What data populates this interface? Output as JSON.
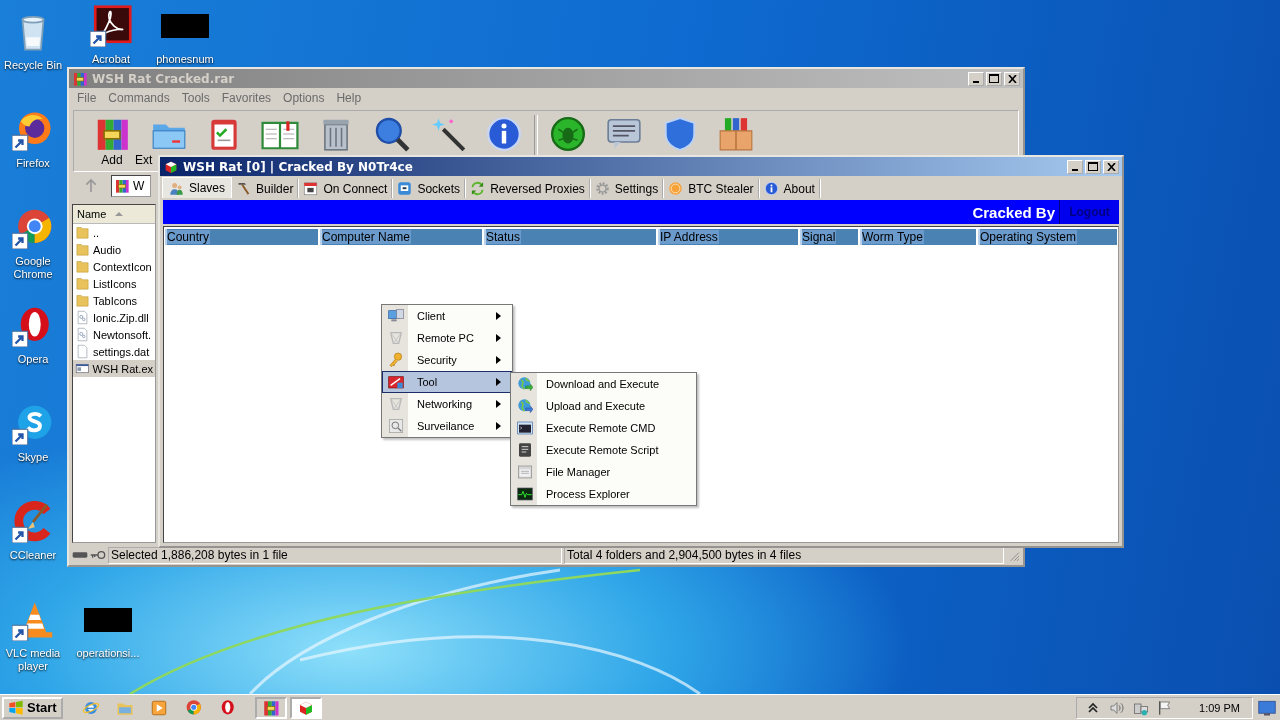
{
  "desktop_icons": [
    {
      "label": "Recycle Bin",
      "kind": "recycle"
    },
    {
      "label": "Acrobat",
      "kind": "acrobat"
    },
    {
      "label": "phonesnum",
      "kind": "redacted"
    },
    {
      "label": "Firefox",
      "kind": "firefox"
    },
    {
      "label": "Google Chrome",
      "kind": "chrome"
    },
    {
      "label": "Opera",
      "kind": "opera"
    },
    {
      "label": "Skype",
      "kind": "skype"
    },
    {
      "label": "CCleaner",
      "kind": "ccleaner"
    },
    {
      "label": "VLC media player",
      "kind": "vlc"
    },
    {
      "label": "operationsi...",
      "kind": "redacted"
    }
  ],
  "archiver_window": {
    "title": "WSH Rat Cracked.rar",
    "menu": [
      "File",
      "Commands",
      "Tools",
      "Favorites",
      "Options",
      "Help"
    ],
    "toolbar": [
      {
        "label": "Add",
        "kind": "books"
      },
      {
        "label": "Ext",
        "kind": "bluefolder"
      },
      {
        "kind": "clipboard"
      },
      {
        "kind": "book"
      },
      {
        "kind": "trash"
      },
      {
        "kind": "magnifier"
      },
      {
        "kind": "wand"
      },
      {
        "kind": "info"
      },
      {
        "kind": "bug"
      },
      {
        "kind": "message"
      },
      {
        "kind": "shield"
      },
      {
        "kind": "box"
      }
    ],
    "path": "W",
    "list_column": "Name",
    "files": [
      {
        "name": "..",
        "kind": "folder",
        "selected": false
      },
      {
        "name": "Audio",
        "kind": "folder",
        "selected": false
      },
      {
        "name": "ContextIcon",
        "kind": "folder",
        "selected": false
      },
      {
        "name": "ListIcons",
        "kind": "folder",
        "selected": false
      },
      {
        "name": "TabIcons",
        "kind": "folder",
        "selected": false
      },
      {
        "name": "Ionic.Zip.dll",
        "kind": "dll",
        "selected": false
      },
      {
        "name": "Newtonsoft.",
        "kind": "dll",
        "selected": false
      },
      {
        "name": "settings.dat",
        "kind": "file",
        "selected": false
      },
      {
        "name": "WSH Rat.ex",
        "kind": "exe",
        "selected": true
      }
    ],
    "status_left": "Selected 1,886,208 bytes in 1 file",
    "status_right": "Total 4 folders and 2,904,500 bytes in 4 files"
  },
  "rat_window": {
    "title": "WSH Rat [0] | Cracked By N0Tr4ce",
    "tabs": [
      {
        "label": "Slaves",
        "kind": "users",
        "selected": true
      },
      {
        "label": "Builder",
        "kind": "hammer",
        "selected": false
      },
      {
        "label": "On Connect",
        "kind": "calendar",
        "selected": false
      },
      {
        "label": "Sockets",
        "kind": "socket",
        "selected": false
      },
      {
        "label": "Reversed Proxies",
        "kind": "cycle",
        "selected": false
      },
      {
        "label": "Settings",
        "kind": "gear",
        "selected": false
      },
      {
        "label": "BTC Stealer",
        "kind": "coin",
        "selected": false
      },
      {
        "label": "About",
        "kind": "info",
        "selected": false
      }
    ],
    "banner_text": "Cracked By",
    "logout_button": "Logout",
    "columns": [
      "Country",
      "Computer Name",
      "Status",
      "IP Address",
      "Signal",
      "Worm Type",
      "Operating System"
    ]
  },
  "context_menu": {
    "items": [
      {
        "label": "Client",
        "kind": "computer",
        "selected": false
      },
      {
        "label": "Remote PC",
        "kind": "netgray",
        "selected": false
      },
      {
        "label": "Security",
        "kind": "key",
        "selected": false
      },
      {
        "label": "Tool",
        "kind": "toolbox",
        "selected": true
      },
      {
        "label": "Networking",
        "kind": "netgray",
        "selected": false
      },
      {
        "label": "Surveilance",
        "kind": "scan",
        "selected": false
      }
    ]
  },
  "submenu": {
    "items": [
      {
        "label": "Download and Execute",
        "kind": "globegreen"
      },
      {
        "label": "Upload and Execute",
        "kind": "globeblue"
      },
      {
        "label": "Execute Remote CMD",
        "kind": "console"
      },
      {
        "label": "Execute Remote Script",
        "kind": "script"
      },
      {
        "label": "File Manager",
        "kind": "filewin"
      },
      {
        "label": "Process Explorer",
        "kind": "chart"
      }
    ]
  },
  "taskbar": {
    "start": "Start",
    "windows": [
      {
        "kind": "books",
        "active": false
      },
      {
        "kind": "ratcube",
        "active": true
      }
    ],
    "clock": "1:09 PM"
  }
}
